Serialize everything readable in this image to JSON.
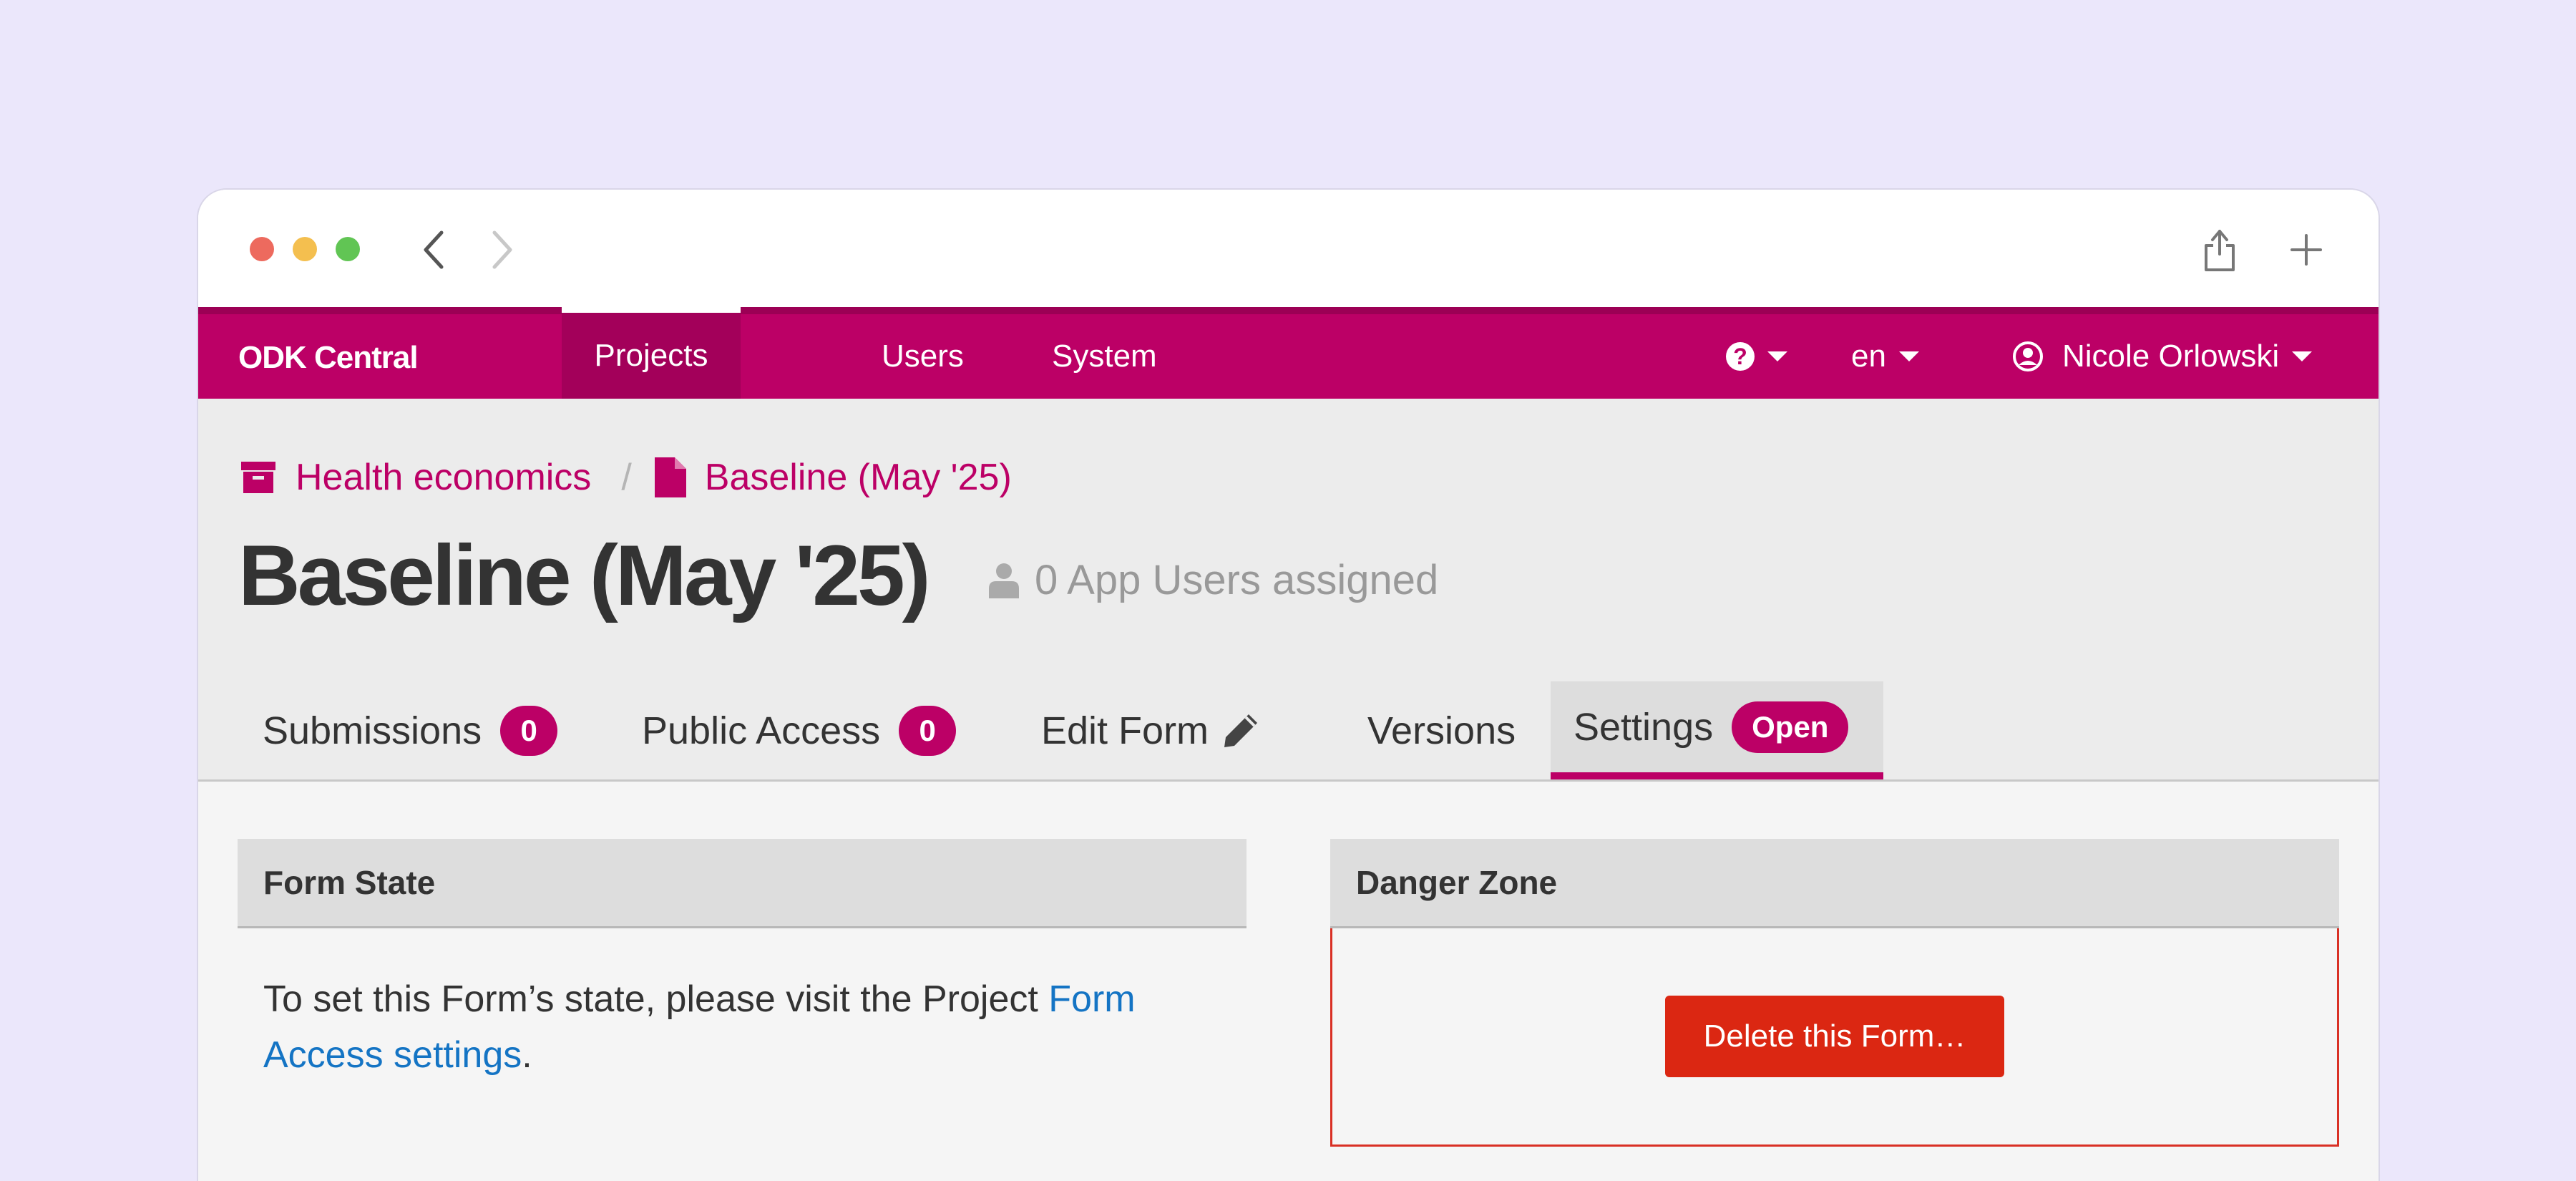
{
  "navbar": {
    "brand": "ODK Central",
    "items": [
      "Projects",
      "Users",
      "System"
    ],
    "help_icon": "question-circle-icon",
    "language": "en",
    "user_name": "Nicole Orlowski"
  },
  "breadcrumb": {
    "project": "Health economics",
    "separator": "/",
    "form": "Baseline (May '25)"
  },
  "page": {
    "title": "Baseline (May '25)",
    "app_users": "0 App Users assigned"
  },
  "tabs": [
    {
      "label": "Submissions",
      "badge": "0"
    },
    {
      "label": "Public Access",
      "badge": "0"
    },
    {
      "label": "Edit Form"
    },
    {
      "label": "Versions"
    },
    {
      "label": "Settings",
      "badge": "Open",
      "active": true
    }
  ],
  "form_state": {
    "heading": "Form State",
    "text_before": "To set this Form’s state, please visit the Project ",
    "link": "Form Access settings",
    "text_after": "."
  },
  "danger_zone": {
    "heading": "Danger Zone",
    "delete_label": "Delete this Form…"
  },
  "colors": {
    "brand": "#bc0066",
    "danger": "#db2712",
    "link": "#1474c4",
    "backdrop": "#ebe7fb"
  }
}
